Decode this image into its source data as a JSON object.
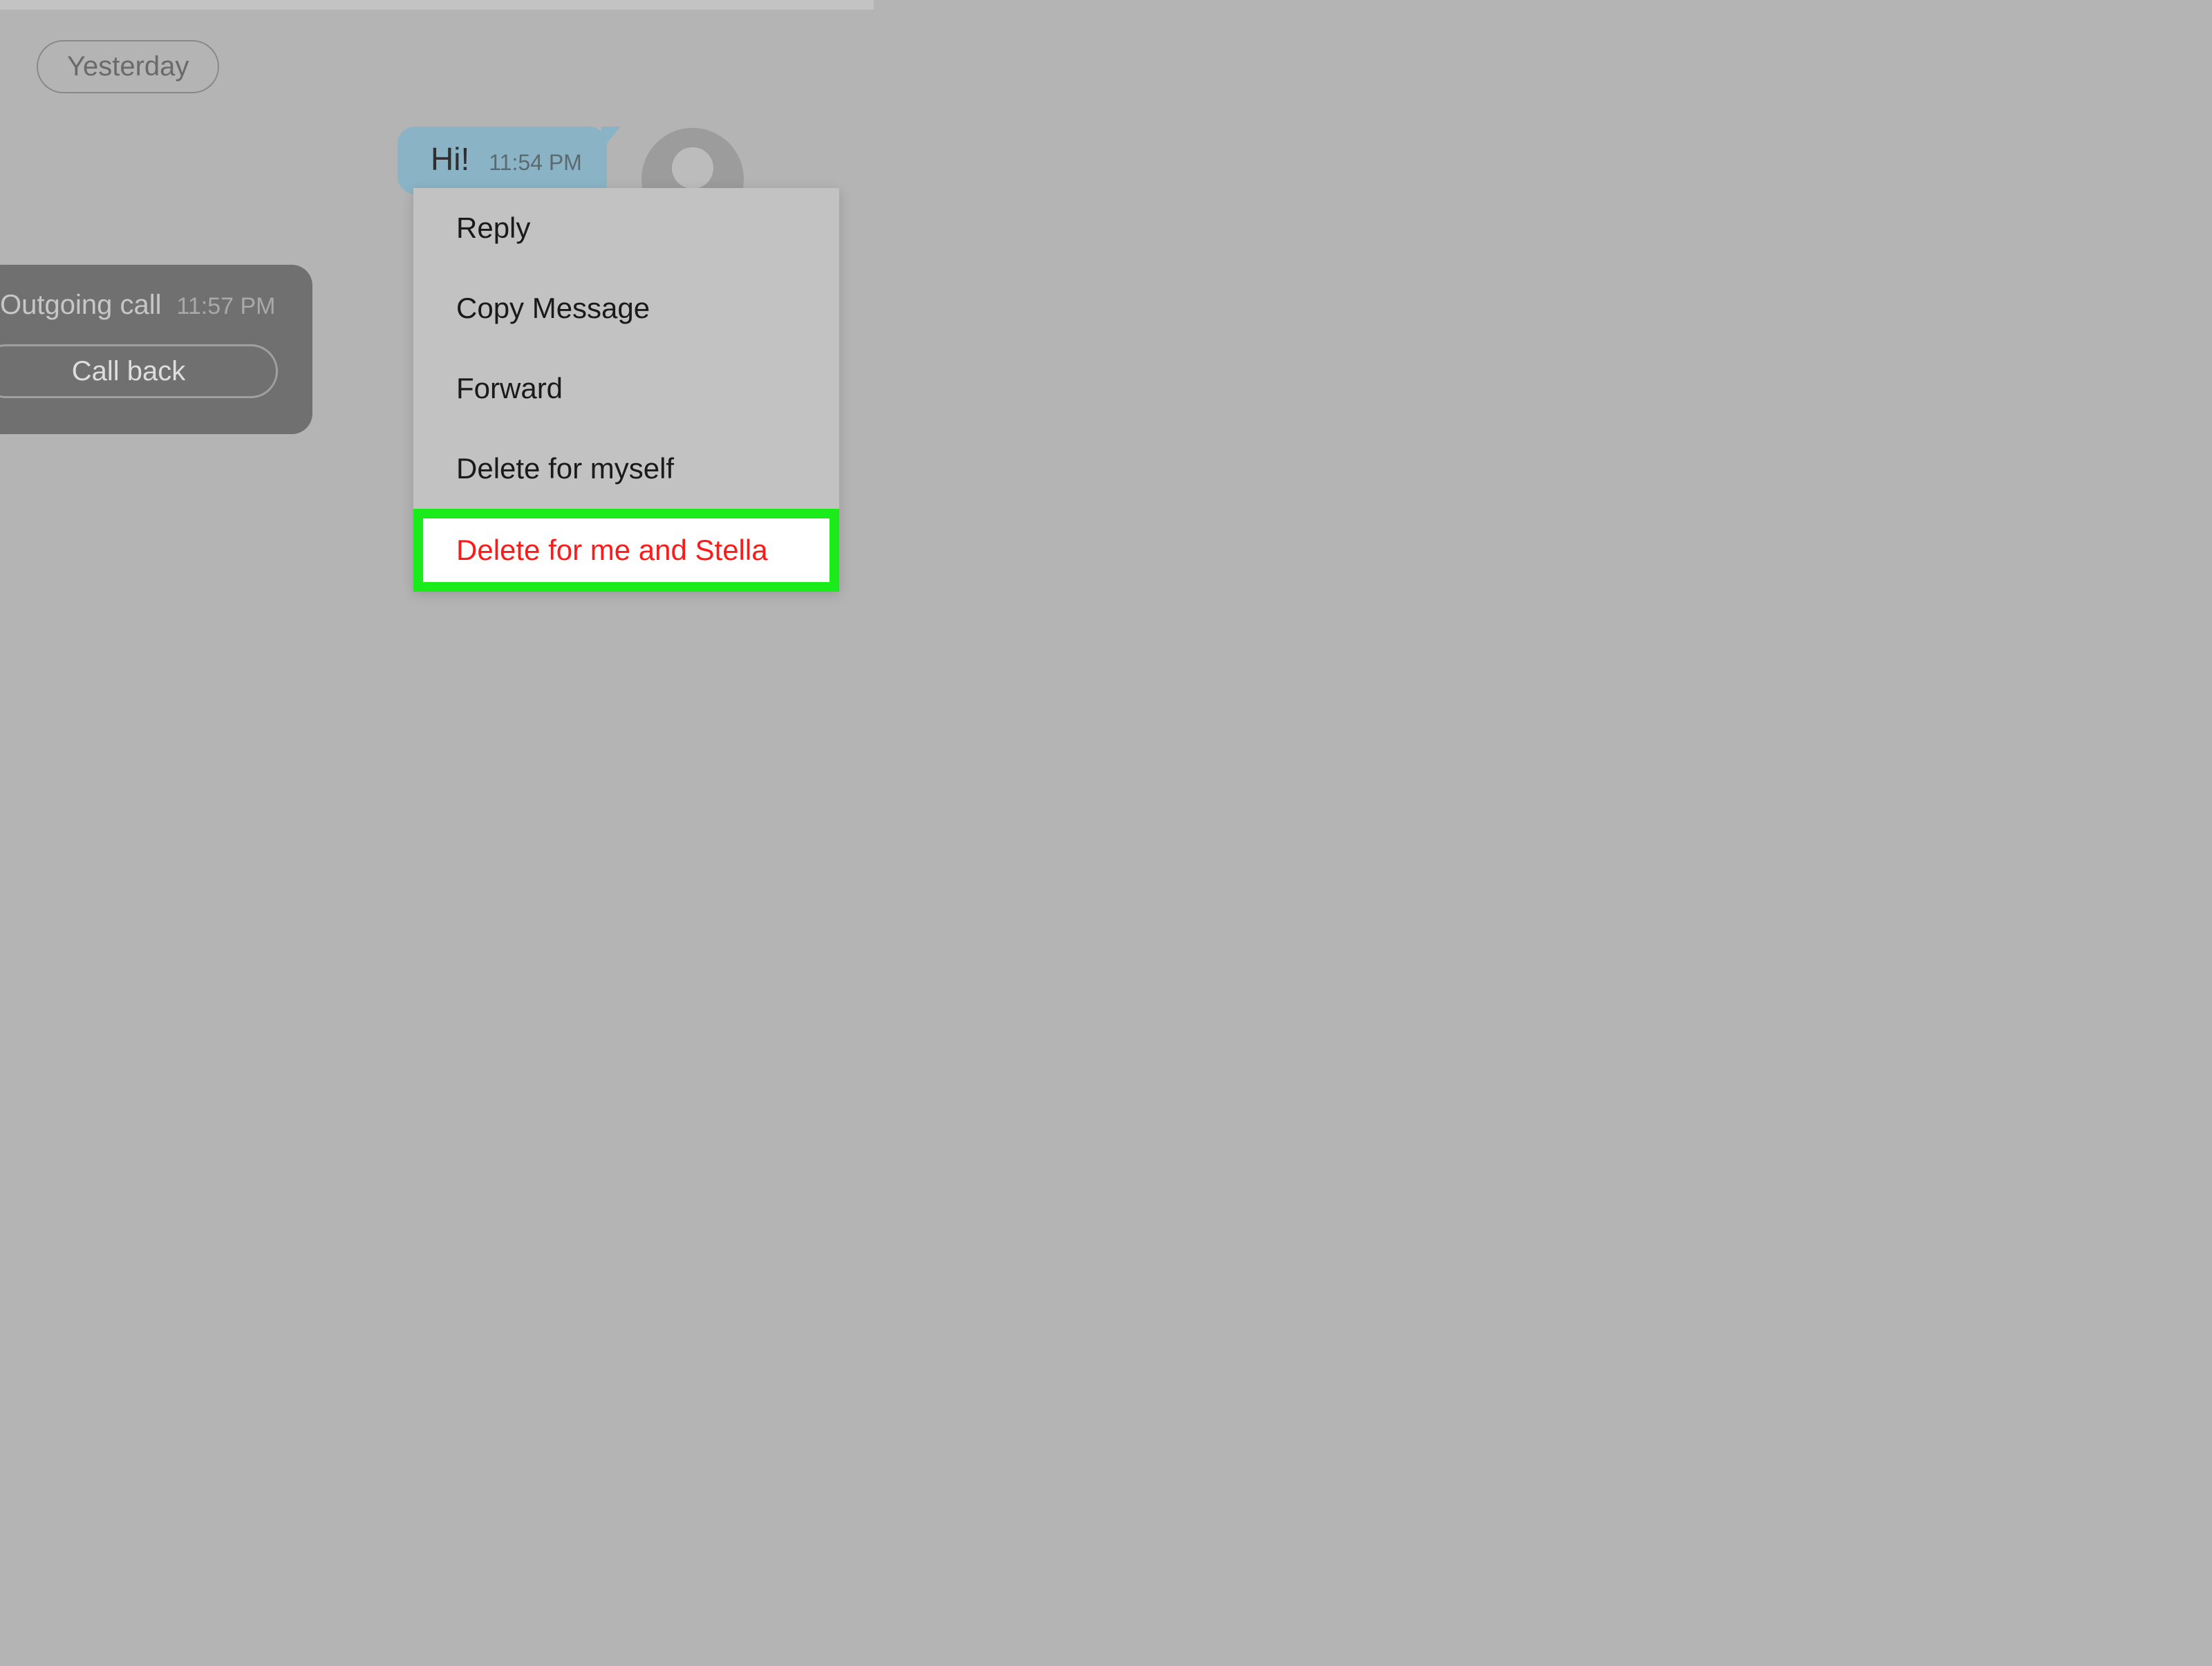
{
  "date_chip": "Yesterday",
  "call": {
    "title": "Outgoing call",
    "time": "11:57 PM",
    "callback_label": "Call back"
  },
  "message": {
    "text": "Hi!",
    "time": "11:54 PM"
  },
  "context_menu": {
    "items": [
      {
        "label": "Reply"
      },
      {
        "label": "Copy Message"
      },
      {
        "label": "Forward"
      },
      {
        "label": "Delete for myself"
      },
      {
        "label": "Delete for me and Stella",
        "highlighted": true
      }
    ]
  }
}
